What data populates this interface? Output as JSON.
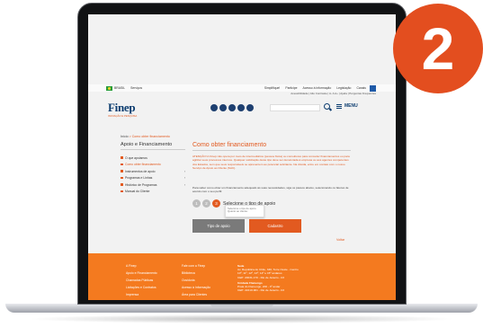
{
  "badge": {
    "number": "2"
  },
  "govbar": {
    "country": "BRASIL",
    "services_label": "Serviços",
    "items": [
      "Simplifique!",
      "Participe",
      "Acesso à informação",
      "Legislação",
      "Canais"
    ]
  },
  "header": {
    "accessibility": "Acessibilidade | Alto Contraste | A- A A+ | Ajuda | Perguntas Frequentes",
    "logo": "Finep",
    "logo_tagline": "INOVAÇÃO E PESQUISA",
    "search_placeholder": "",
    "menu_label": "MENU"
  },
  "breadcrumb": {
    "home": "Início",
    "separator": " > ",
    "current": "Como obter financiamento"
  },
  "sidebar": {
    "title": "Apoio e Financiamento",
    "items": [
      {
        "label": "O que apoiamos",
        "active": false,
        "has_sub": false
      },
      {
        "label": "Como obter financiamento",
        "active": true,
        "has_sub": false
      },
      {
        "label": "Instrumentos de apoio",
        "active": false,
        "has_sub": true
      },
      {
        "label": "Programas e Linhas",
        "active": false,
        "has_sub": true
      },
      {
        "label": "Histórico de Programas",
        "active": false,
        "has_sub": true
      },
      {
        "label": "Manual do Cliente",
        "active": false,
        "has_sub": false
      }
    ],
    "chevron": "›"
  },
  "content": {
    "title": "Como obter financiamento",
    "para1": "ATENÇÃO! A Finep não opera por meio de intermediários (pessoa física) ou consultores para conceder financiamentos ou para agilizar seus processos internos. Qualquer solicitação deste tipo deve ser denunciada à empresa ou aos agentes competentes dos Estados, sem que seus responsáveis se apresentem ao potencial solicitante. Na dúvida, entre em contato com o nosso Serviço de Apoio ao Cliente (SAC).",
    "para2": "Para saber como obter um financiamento adequado às suas necessidades, siga os passos abaixo, selecionando os fatores de acordo com o seu perfil:",
    "steps": [
      "1",
      "2",
      "3"
    ],
    "step_label": "Selecione o tipo de apoio",
    "tooltip": "Selecione o tipo de apoio. Quanto ao cliente:",
    "btn_left": "Tipo de apoio",
    "btn_right": "Cadastro",
    "back": "Voltar"
  },
  "footer": {
    "col1": [
      "A Finep",
      "Apoio e Financiamento",
      "Chamadas Públicas",
      "Licitações e Contratos",
      "Imprensa"
    ],
    "col2": [
      "Fale com a Finep",
      "Biblioteca",
      "Ouvidoria",
      "Acesso à Informação",
      "Área para Clientes"
    ],
    "address": {
      "title": "Sede",
      "line1": "Av. República do Chile, 330, Torre Oeste - Centro",
      "line2": "10º, 11º, 12º, 13º, 14º e 15º andares",
      "line3": "CEP: 20031-170 - Rio de Janeiro - RJ",
      "title2": "Unidade Flamengo",
      "line4": "Praia do Flamengo, 200 - 3º andar",
      "line5": "CEP: 22210-901 - Rio de Janeiro - RJ"
    }
  },
  "colors": {
    "accent": "#e25a20",
    "footer": "#f47a1f",
    "navy": "#0b3c6f",
    "badge": "#e34e1f"
  },
  "icons": [
    "brazil-flag-icon",
    "social-icon",
    "search-icon",
    "menu-icon",
    "chevron-right-icon"
  ]
}
